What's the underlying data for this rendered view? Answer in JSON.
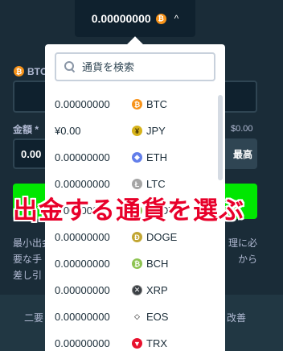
{
  "wallet": {
    "balance": "0.00000000",
    "currency_icon": "btc-coin-icon",
    "chevron": "^"
  },
  "form": {
    "currency_label": "BTC",
    "amount_label": "金額 *",
    "amount_value": "0.00",
    "fiat_value": "$0.00",
    "max_label": "最高",
    "note_line1": "最小出金額は",
    "note_line1_right": "理に必",
    "note_line2": "要な手",
    "note_line2_right": "から",
    "note_line3": "差し引",
    "footer_left": "二要",
    "footer_right": "改善"
  },
  "dropdown": {
    "search_placeholder": "通貨を検索",
    "currencies": [
      {
        "balance": "0.00000000",
        "code": "BTC",
        "icon": "btc-coin-icon",
        "glyph": "₿",
        "cls": "btc"
      },
      {
        "balance": "¥0.00",
        "code": "JPY",
        "icon": "jpy-coin-icon",
        "glyph": "¥",
        "cls": "jpy"
      },
      {
        "balance": "0.00000000",
        "code": "ETH",
        "icon": "eth-coin-icon",
        "glyph": "◆",
        "cls": "eth"
      },
      {
        "balance": "0.00000000",
        "code": "LTC",
        "icon": "ltc-coin-icon",
        "glyph": "Ł",
        "cls": "ltc"
      },
      {
        "balance": "0.00000000",
        "code": "USDT",
        "icon": "usdt-coin-icon",
        "glyph": "₮",
        "cls": "bch"
      },
      {
        "balance": "0.00000000",
        "code": "DOGE",
        "icon": "doge-coin-icon",
        "glyph": "Ð",
        "cls": "doge"
      },
      {
        "balance": "0.00000000",
        "code": "BCH",
        "icon": "bch-coin-icon",
        "glyph": "₿",
        "cls": "bch"
      },
      {
        "balance": "0.00000000",
        "code": "XRP",
        "icon": "xrp-coin-icon",
        "glyph": "✕",
        "cls": "xrp"
      },
      {
        "balance": "0.00000000",
        "code": "EOS",
        "icon": "eos-coin-icon",
        "glyph": "◇",
        "cls": "eos"
      },
      {
        "balance": "0.00000000",
        "code": "TRX",
        "icon": "trx-coin-icon",
        "glyph": "▼",
        "cls": "trx"
      }
    ]
  },
  "annotation": {
    "text": "出金する通貨を選ぶ"
  }
}
